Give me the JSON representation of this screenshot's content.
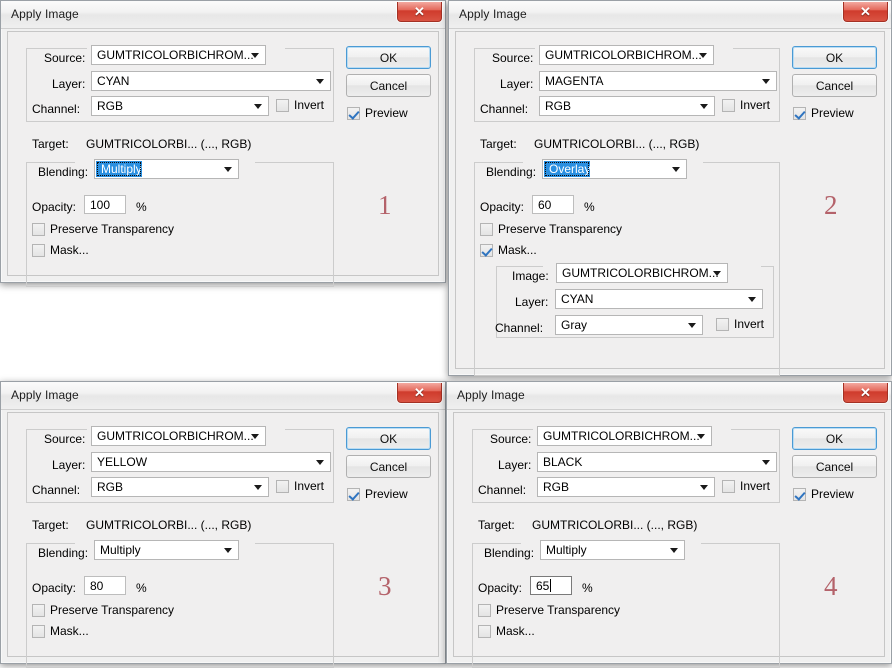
{
  "app": {
    "title": "Apply Image",
    "close_icon": "close-x-icon",
    "dropdown_icon": "chevron-down-icon"
  },
  "labels": {
    "source": "Source:",
    "layer": "Layer:",
    "channel": "Channel:",
    "invert": "Invert",
    "target": "Target:",
    "blending": "Blending:",
    "opacity": "Opacity:",
    "percent": "%",
    "preserve_transparency": "Preserve Transparency",
    "mask": "Mask...",
    "image": "Image:",
    "ok": "OK",
    "cancel": "Cancel",
    "preview": "Preview"
  },
  "dialogs": [
    {
      "marker": "1",
      "title": "Apply Image",
      "source": "GUMTRICOLORBICHROM...",
      "layer": "CYAN",
      "channel": "RGB",
      "invert_checked": false,
      "target": "GUMTRICOLORBI... (..., RGB)",
      "blending": "Multiply",
      "blending_selected": true,
      "opacity": "100",
      "opacity_focused": false,
      "preserve_checked": false,
      "mask_checked": false,
      "preview_checked": true,
      "mask": null
    },
    {
      "marker": "2",
      "title": "Apply Image",
      "source": "GUMTRICOLORBICHROM...",
      "layer": "MAGENTA",
      "channel": "RGB",
      "invert_checked": false,
      "target": "GUMTRICOLORBI... (..., RGB)",
      "blending": "Overlay",
      "blending_selected": true,
      "opacity": "60",
      "opacity_focused": false,
      "preserve_checked": false,
      "mask_checked": true,
      "preview_checked": true,
      "mask": {
        "image": "GUMTRICOLORBICHROM...",
        "layer": "CYAN",
        "channel": "Gray",
        "invert_checked": false
      }
    },
    {
      "marker": "3",
      "title": "Apply Image",
      "source": "GUMTRICOLORBICHROM...",
      "layer": "YELLOW",
      "channel": "RGB",
      "invert_checked": false,
      "target": "GUMTRICOLORBI... (..., RGB)",
      "blending": "Multiply",
      "blending_selected": false,
      "opacity": "80",
      "opacity_focused": false,
      "preserve_checked": false,
      "mask_checked": false,
      "preview_checked": true,
      "mask": null
    },
    {
      "marker": "4",
      "title": "Apply Image",
      "source": "GUMTRICOLORBICHROM...",
      "layer": "BLACK",
      "channel": "RGB",
      "invert_checked": false,
      "target": "GUMTRICOLORBI... (..., RGB)",
      "blending": "Multiply",
      "blending_selected": false,
      "opacity": "65",
      "opacity_focused": true,
      "preserve_checked": false,
      "mask_checked": false,
      "preview_checked": true,
      "mask": null
    }
  ],
  "colors": {
    "selection_blue": "#2a8fe0",
    "close_red": "#cf3b2c",
    "marker_rose": "#b4626a",
    "dialog_face": "#f0efef"
  }
}
